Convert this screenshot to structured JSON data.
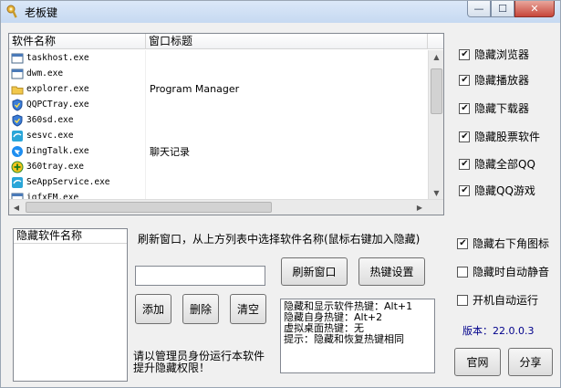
{
  "window": {
    "title": "老板键",
    "controls": {
      "minimize": "—",
      "maximize": "☐",
      "close": "✕"
    }
  },
  "process_list": {
    "headers": {
      "name": "软件名称",
      "title": "窗口标题"
    },
    "rows": [
      {
        "name": "taskhost.exe",
        "title": "",
        "icon": "window-app-icon"
      },
      {
        "name": "dwm.exe",
        "title": "",
        "icon": "window-app-icon"
      },
      {
        "name": "explorer.exe",
        "title": "Program Manager",
        "icon": "folder-icon"
      },
      {
        "name": "QQPCTray.exe",
        "title": "",
        "icon": "shield-icon"
      },
      {
        "name": "360sd.exe",
        "title": "",
        "icon": "shield-icon"
      },
      {
        "name": "sesvc.exe",
        "title": "",
        "icon": "browser-icon"
      },
      {
        "name": "DingTalk.exe",
        "title": "聊天记录",
        "icon": "dingtalk-icon"
      },
      {
        "name": "360tray.exe",
        "title": "",
        "icon": "plus-circle-icon"
      },
      {
        "name": "SeAppService.exe",
        "title": "",
        "icon": "browser-icon"
      },
      {
        "name": "igfxEM.exe",
        "title": "",
        "icon": "window-app-icon"
      }
    ]
  },
  "options": {
    "hide_browser": {
      "label": "隐藏浏览器",
      "checked": true
    },
    "hide_player": {
      "label": "隐藏播放器",
      "checked": true
    },
    "hide_downloader": {
      "label": "隐藏下载器",
      "checked": true
    },
    "hide_stock": {
      "label": "隐藏股票软件",
      "checked": true
    },
    "hide_all_qq": {
      "label": "隐藏全部QQ",
      "checked": true
    },
    "hide_qq_games": {
      "label": "隐藏QQ游戏",
      "checked": true
    },
    "hide_tray_icon": {
      "label": "隐藏右下角图标",
      "checked": true
    },
    "auto_mute": {
      "label": "隐藏时自动静音",
      "checked": false
    },
    "autostart": {
      "label": "开机自动运行",
      "checked": false
    }
  },
  "hidden_list": {
    "header": "隐藏软件名称"
  },
  "instructions": "刷新窗口，从上方列表中选择软件名称(鼠标右键加入隐藏)",
  "input": {
    "value": ""
  },
  "buttons": {
    "refresh": "刷新窗口",
    "hotkey_settings": "热键设置",
    "add": "添加",
    "delete": "删除",
    "clear": "清空",
    "website": "官网",
    "share": "分享"
  },
  "hotkeys": [
    "隐藏和显示软件热键：Alt+1",
    "隐藏自身热键：Alt+2",
    "虚拟桌面热键：无",
    "提示：隐藏和恢复热键相同"
  ],
  "admin_note": [
    "请以管理员身份运行本软件",
    "提升隐藏权限！"
  ],
  "version": "版本：22.0.0.3",
  "colors": {
    "version_text": "#00008b",
    "close_button": "#c7463a"
  }
}
